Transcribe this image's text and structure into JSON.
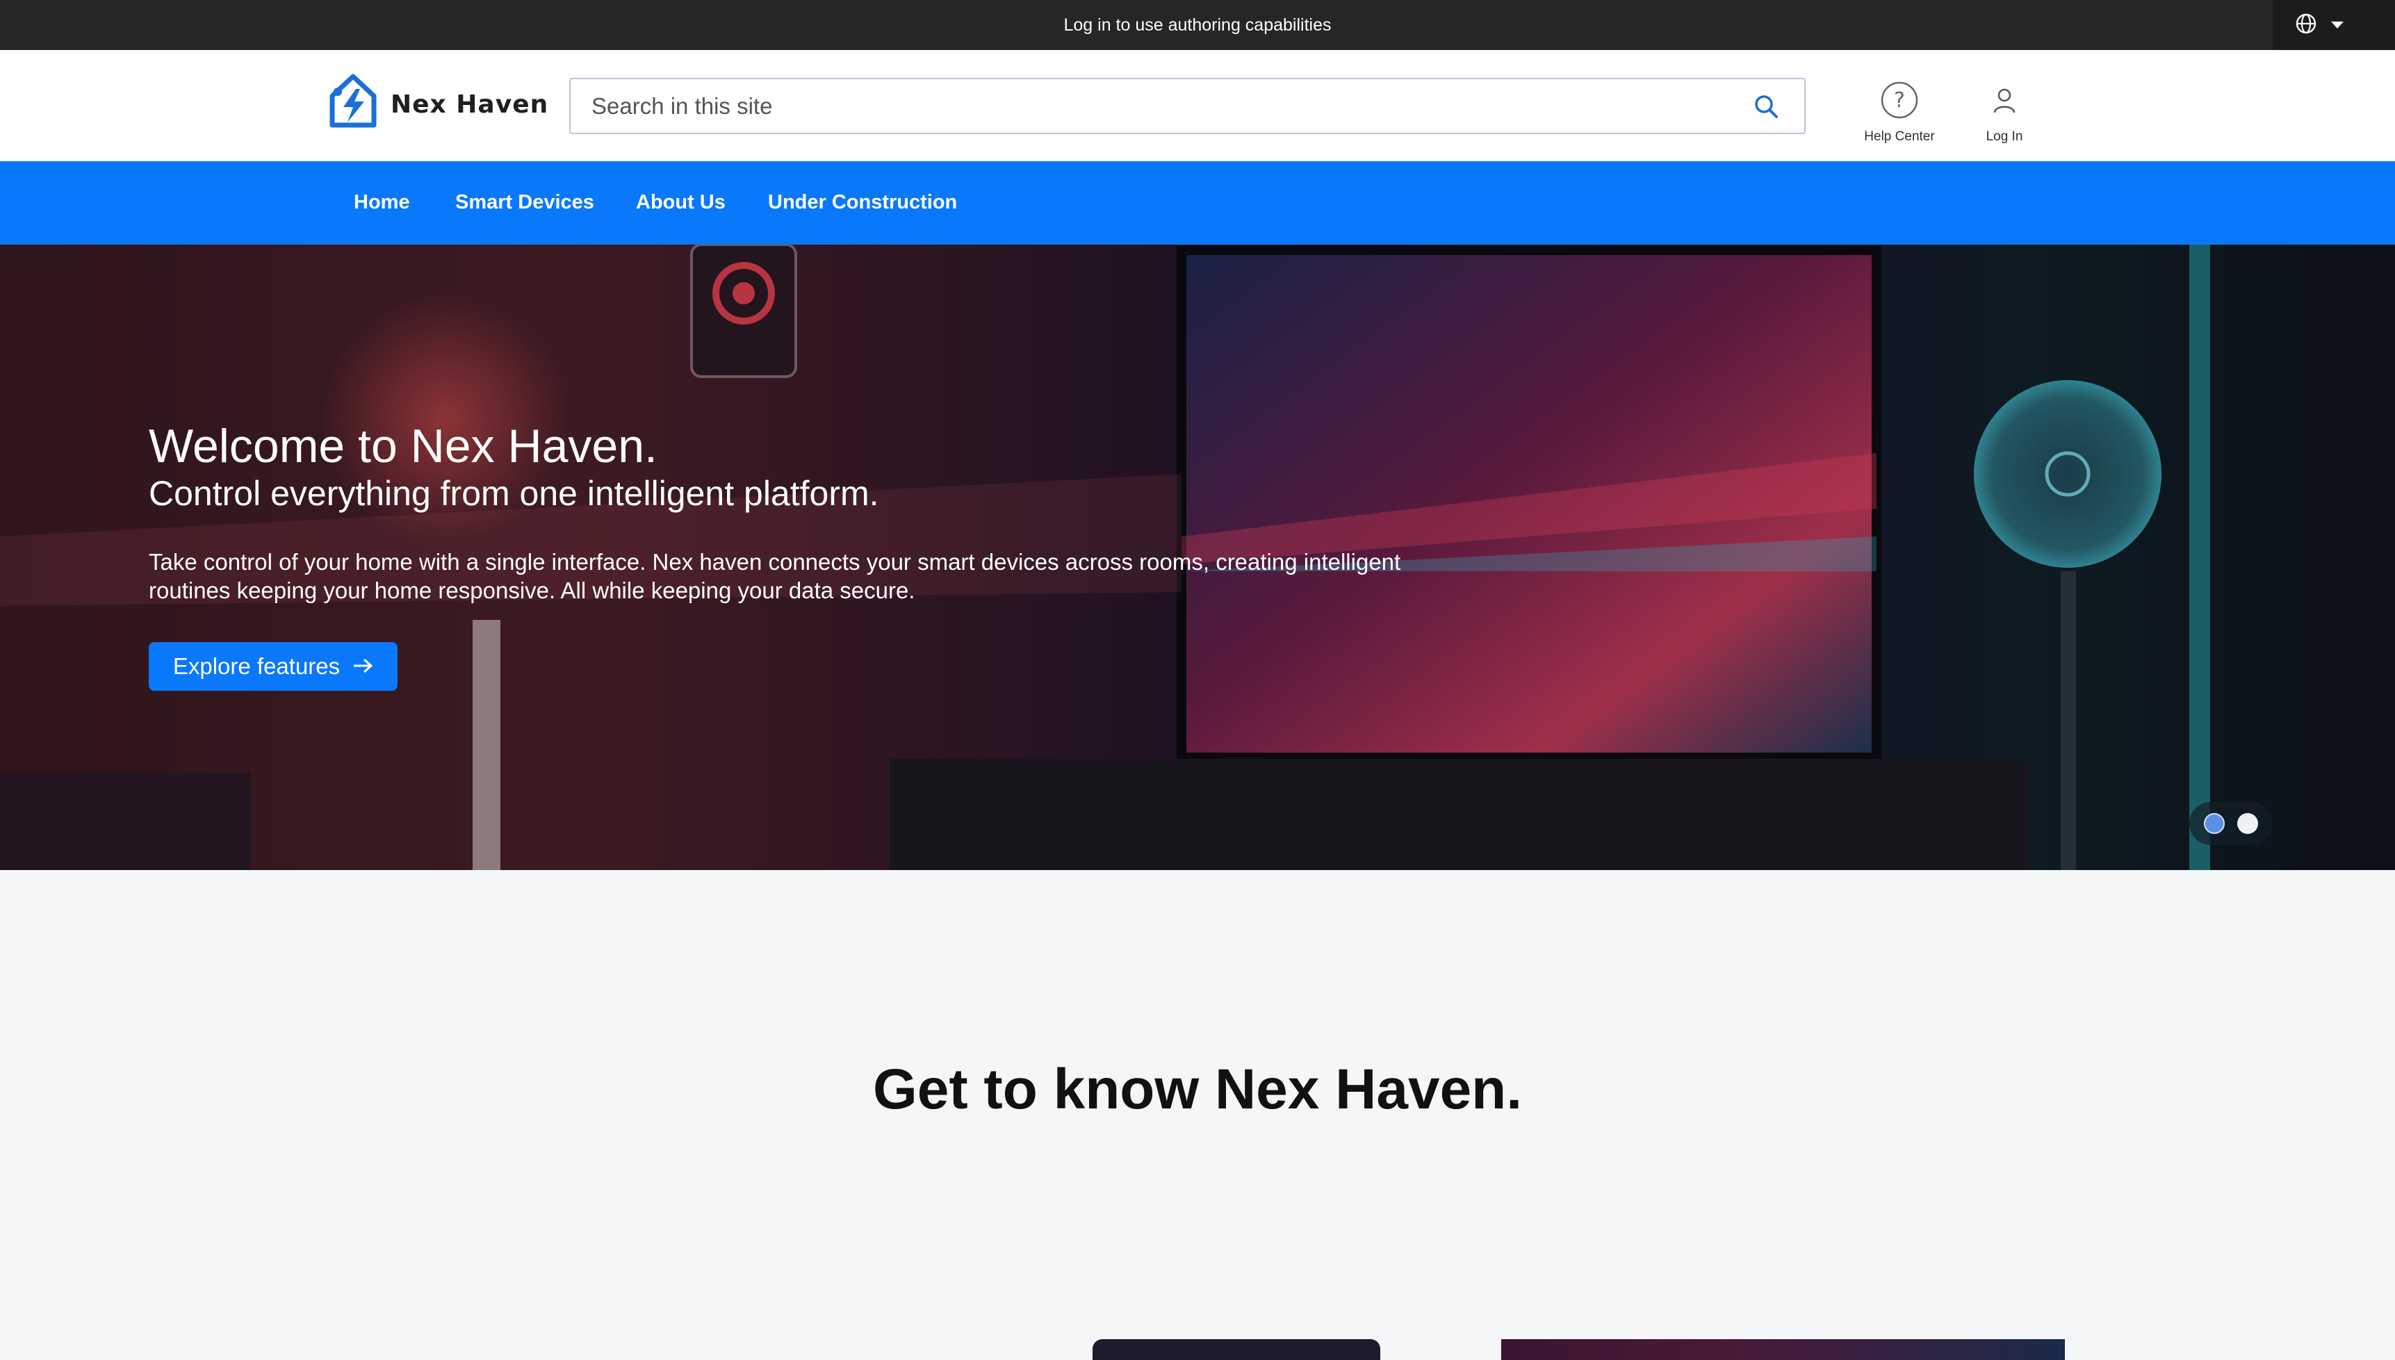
{
  "topbar": {
    "message": "Log in to use authoring capabilities",
    "language_icon": "globe-icon"
  },
  "header": {
    "logo_text": "Nex Haven",
    "logo_icon": "house-bolt-icon",
    "search": {
      "placeholder": "Search in this site",
      "value": "",
      "icon": "search-icon"
    },
    "help": {
      "label": "Help Center",
      "icon": "question-circle-icon"
    },
    "login": {
      "label": "Log In",
      "icon": "user-icon"
    }
  },
  "nav": {
    "items": [
      {
        "label": "Home"
      },
      {
        "label": "Smart Devices"
      },
      {
        "label": "About Us"
      },
      {
        "label": "Under Construction"
      }
    ]
  },
  "hero": {
    "title": "Welcome to Nex Haven.",
    "subtitle": "Control everything from one intelligent platform.",
    "body_line1": "Take control of your home with a single interface. Nex haven connects your smart devices across rooms, creating intelligent",
    "body_line2": "routines keeping your home responsive. All while keeping your data secure.",
    "cta_label": "Explore features",
    "cta_icon": "arrow-right-icon",
    "slide_active": 1,
    "slide_count": 2
  },
  "section": {
    "title": "Get to know Nex Haven."
  },
  "colors": {
    "brand_blue": "#0a78fb",
    "topbar": "#262626"
  }
}
